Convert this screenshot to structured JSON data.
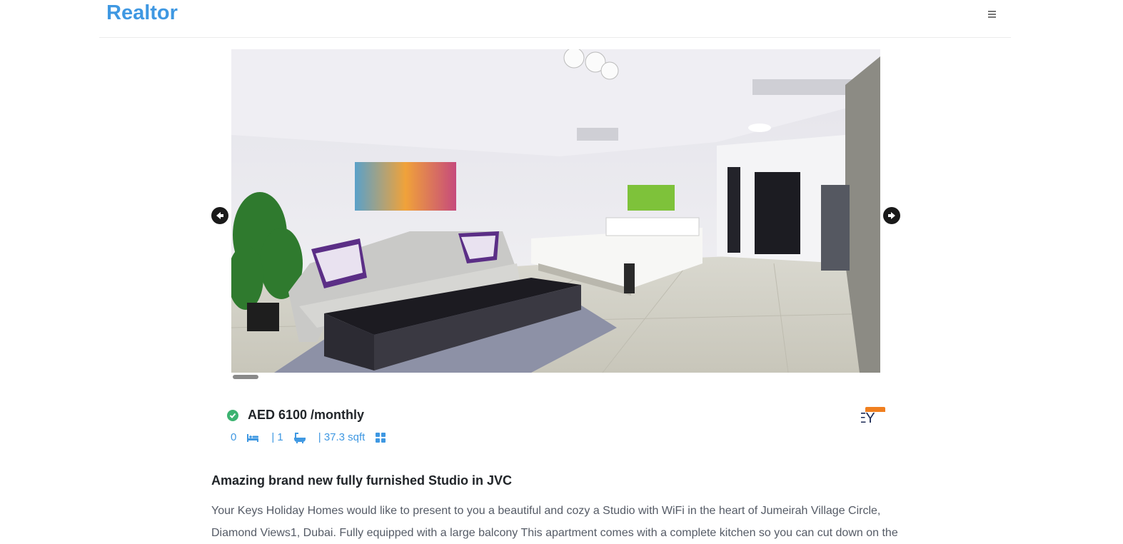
{
  "header": {
    "brand": "Realtor",
    "menu_icon": "hamburger-menu-icon"
  },
  "gallery": {
    "current_slide": 1,
    "prev_icon": "arrow-left-icon",
    "next_icon": "arrow-right-icon"
  },
  "listing": {
    "verified_icon": "check-circle-icon",
    "price": "AED 6100 /monthly",
    "bedrooms": "0",
    "bathrooms": "| 1",
    "area": "| 37.3 sqft",
    "bed_icon": "bed-icon",
    "bath_icon": "bathtub-icon",
    "area_icon": "grid-icon",
    "agency_logo_text": "EY",
    "title": "Amazing brand new fully furnished Studio in JVC",
    "description": "Your Keys Holiday Homes would like to present to you a beautiful and cozy a Studio with WiFi in the heart of Jumeirah Village Circle, Diamond Views1, Dubai. Fully equipped with a large balcony This apartment comes with a complete kitchen so you can cut down on the"
  },
  "colors": {
    "brand": "#3f98e2",
    "verified": "#3cb371",
    "features": "#3f98e2",
    "agency_accent": "#f07f1f",
    "agency_text": "#1b2a55"
  }
}
